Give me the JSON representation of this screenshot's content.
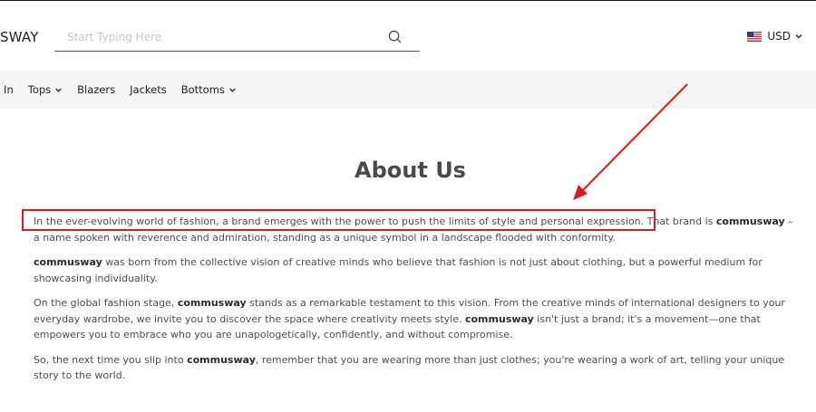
{
  "header": {
    "logo_text": "SWAY",
    "search": {
      "placeholder": "Start Typing Here",
      "value": ""
    },
    "currency": {
      "label": "USD"
    }
  },
  "nav": {
    "items": [
      {
        "label": "w In",
        "has_dropdown": false
      },
      {
        "label": "Tops",
        "has_dropdown": true
      },
      {
        "label": "Blazers",
        "has_dropdown": false
      },
      {
        "label": "Jackets",
        "has_dropdown": false
      },
      {
        "label": "Bottoms",
        "has_dropdown": true
      }
    ]
  },
  "page": {
    "title": "About Us",
    "paragraphs": [
      {
        "parts": [
          "In the ever-evolving world of fashion, a brand emerges with the power to push the limits of style and personal expression. That brand is ",
          "commusway",
          " – a name spoken with reverence and admiration, standing as a unique symbol in a landscape flooded with conformity."
        ]
      },
      {
        "parts": [
          "",
          "commusway",
          " was born from the collective vision of creative minds who believe that fashion is not just about clothing, but a powerful medium for showcasing individuality."
        ]
      },
      {
        "parts": [
          "On the global fashion stage, ",
          "commusway",
          " stands as a remarkable testament to this vision. From the creative minds of international designers to your everyday wardrobe, we invite you to discover the space where creativity meets style. ",
          "commusway",
          " isn't just a brand; it's a movement—one that empowers you to embrace who you are unapologetically, confidently, and without compromise."
        ]
      },
      {
        "parts": [
          "So, the next time you slip into ",
          "commusway",
          ", remember that you are wearing more than just clothes; you're wearing a work of art, telling your unique story to the world."
        ]
      }
    ]
  },
  "annotation": {
    "color": "#e0181e"
  },
  "icons": {
    "search": "search-icon",
    "flag": "us-flag-icon",
    "dropdown": "chevron-down-icon"
  }
}
